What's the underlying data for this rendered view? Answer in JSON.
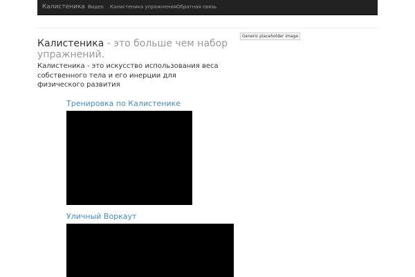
{
  "navbar": {
    "brand": "Калистеника",
    "links": [
      {
        "label": "Видео"
      },
      {
        "label": "Калистеника упражнения"
      },
      {
        "label": "Обратная связь"
      }
    ]
  },
  "hero": {
    "title_main": "Калистеника",
    "title_muted": " - это больше чем набор упражнений.",
    "lead": "Калистеника - это искусство использования веса собственного тела и его инерции для физического развития"
  },
  "placeholder_image": {
    "alt": "Generic placeholder image"
  },
  "videos": [
    {
      "title": "Тренировка по Калистенике"
    },
    {
      "title": "Уличный Воркаут"
    }
  ],
  "colors": {
    "navbar_bg": "#222222",
    "nav_text": "#9d9d9d",
    "link": "#428bca",
    "muted": "#999999",
    "video_bg": "#000000"
  }
}
